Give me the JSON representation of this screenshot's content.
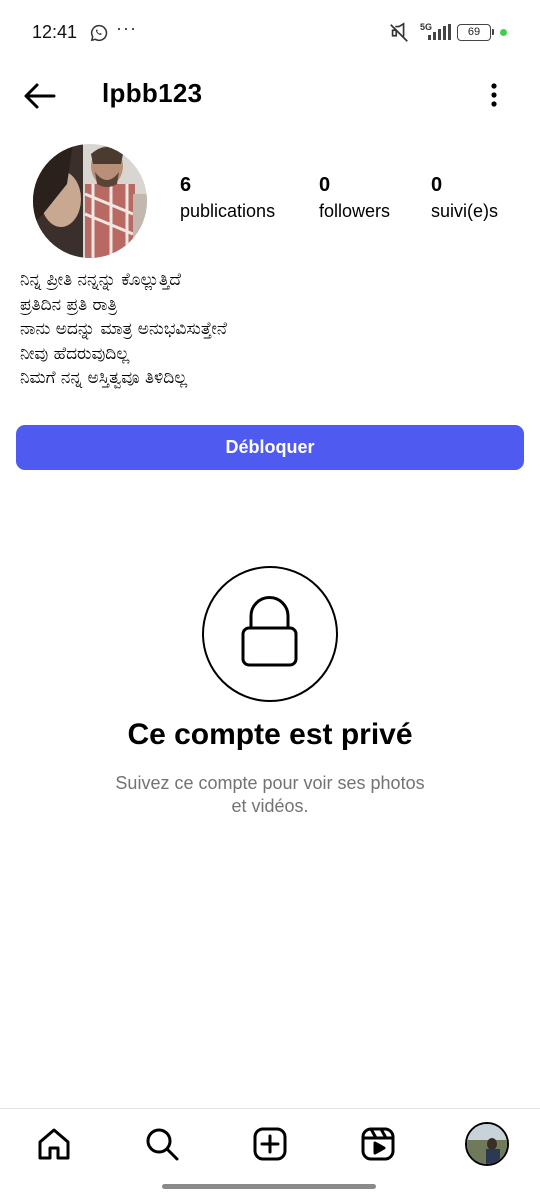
{
  "status_bar": {
    "time": "12:41",
    "overflow": "···",
    "network": "5G",
    "battery": "69",
    "icons": [
      "whatsapp-icon",
      "mute-icon",
      "signal-icon",
      "battery-icon"
    ]
  },
  "header": {
    "username": "lpbb123",
    "back_icon": "arrow-left-icon",
    "more_icon": "more-vertical-icon"
  },
  "profile": {
    "stats": [
      {
        "count": "6",
        "label": "publications"
      },
      {
        "count": "0",
        "label": "followers"
      },
      {
        "count": "0",
        "label": "suivi(e)s"
      }
    ],
    "bio": [
      "ನಿನ್ನ ಪ್ರೀತಿ ನನ್ನನ್ನು ಕೊಲ್ಲುತ್ತಿದೆ",
      "ಪ್ರತಿದಿನ ಪ್ರತಿ ರಾತ್ರಿ",
      "ನಾನು ಅದನ್ನು ಮಾತ್ರ ಅನುಭವಿಸುತ್ತೇನೆ",
      "ನೀವು ಹೆದರುವುದಿಲ್ಲ",
      "ನಿಮಗೆ ನನ್ನ ಅಸ್ತಿತ್ವವೂ ತಿಳಿದಿಲ್ಲ"
    ],
    "unblock_label": "Débloquer"
  },
  "private": {
    "title": "Ce compte est privé",
    "subtitle": "Suivez ce compte pour voir ses photos et vidéos.",
    "icon": "lock-icon"
  },
  "bottom_nav": {
    "items": [
      "home-icon",
      "search-icon",
      "create-icon",
      "reels-icon",
      "profile-avatar"
    ]
  },
  "colors": {
    "accent": "#4f5bf0",
    "secondary_text": "#737373"
  }
}
